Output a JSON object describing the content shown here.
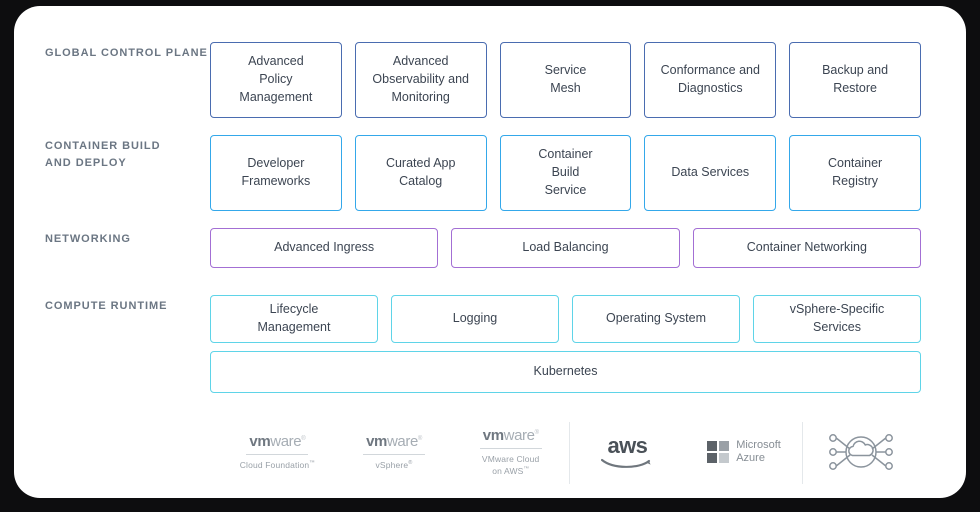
{
  "diagram": {
    "title": "VMware Tanzu / Kubernetes platform layers",
    "rows": [
      {
        "id": "global-control-plane",
        "label": "Global Control Plane",
        "accent": "#4a6cb0",
        "boxes": [
          "Advanced\nPolicy\nManagement",
          "Advanced\nObservability and\nMonitoring",
          "Service\nMesh",
          "Conformance and\nDiagnostics",
          "Backup and\nRestore"
        ]
      },
      {
        "id": "container-build-and-deploy",
        "label": "Container Build\nand Deploy",
        "accent": "#34a8ea",
        "boxes": [
          "Developer\nFrameworks",
          "Curated App\nCatalog",
          "Container\nBuild\nService",
          "Data Services",
          "Container\nRegistry"
        ]
      },
      {
        "id": "networking",
        "label": "Networking",
        "accent": "#a36fd4",
        "boxes": [
          "Advanced Ingress",
          "Load Balancing",
          "Container Networking"
        ]
      },
      {
        "id": "compute-runtime",
        "label": "Compute Runtime",
        "accent": "#5fd4e8",
        "boxes": [
          "Lifecycle\nManagement",
          "Logging",
          "Operating System",
          "vSphere-Specific\nServices"
        ]
      },
      {
        "id": "kubernetes-base",
        "label": "",
        "accent": "#5fd4e8",
        "boxes": [
          "Kubernetes"
        ]
      }
    ]
  },
  "footer": {
    "logos": [
      {
        "id": "vmware-cloud-foundation",
        "type": "vmware",
        "brand_bold": "vm",
        "brand_light": "ware",
        "trademark": "®",
        "product": "Cloud Foundation",
        "product_trademark": "™"
      },
      {
        "id": "vmware-vsphere",
        "type": "vmware",
        "brand_bold": "vm",
        "brand_light": "ware",
        "trademark": "®",
        "product": "vSphere",
        "product_trademark": "®"
      },
      {
        "id": "vmware-cloud-on-aws",
        "type": "vmware",
        "brand_bold": "vm",
        "brand_light": "ware",
        "trademark": "®",
        "product": "VMware Cloud\non AWS",
        "product_trademark": "™"
      },
      {
        "id": "aws",
        "type": "aws",
        "wordmark": "aws"
      },
      {
        "id": "microsoft-azure",
        "type": "azure",
        "text": "Microsoft\nAzure"
      },
      {
        "id": "cloud-network",
        "type": "network-icon",
        "alt": "cloud network icon"
      }
    ]
  },
  "colors": {
    "control_plane": "#4a6cb0",
    "build_deploy": "#34a8ea",
    "networking": "#a36fd4",
    "compute_runtime": "#5fd4e8",
    "label_text": "#6b7683",
    "box_text": "#3c4552",
    "page_background": "#0d0d0f",
    "card_background": "#ffffff"
  }
}
